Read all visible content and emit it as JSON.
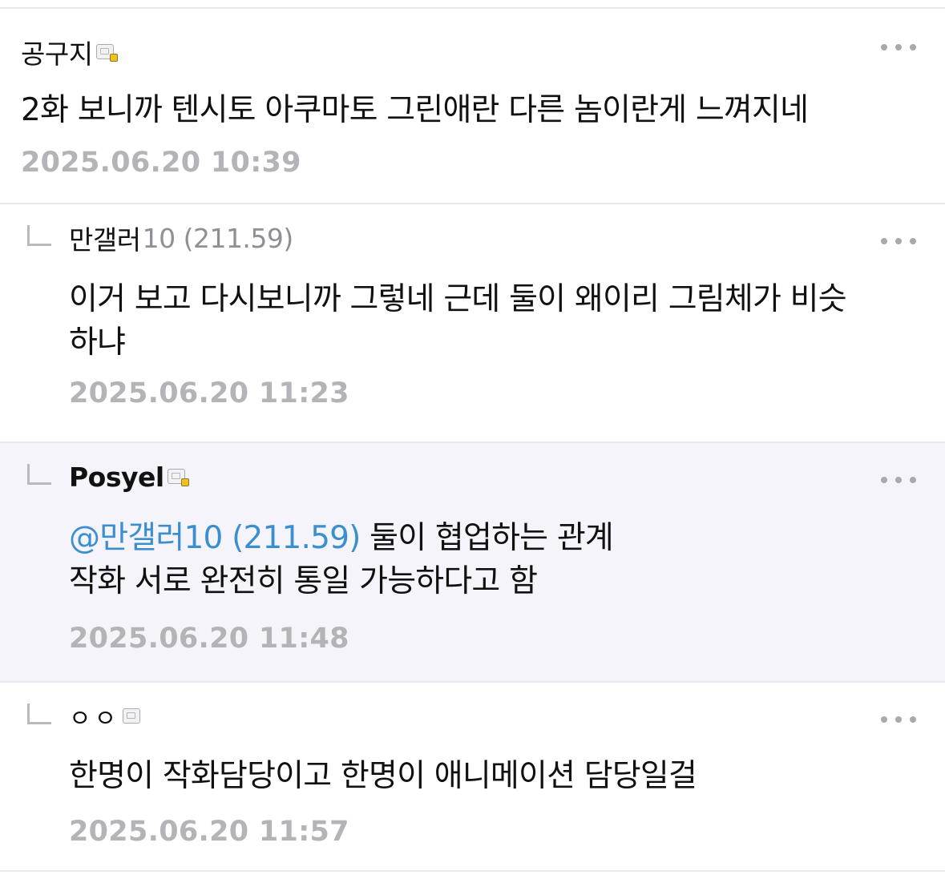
{
  "comments": [
    {
      "author": "공구지",
      "author_id": "",
      "body": "2화 보니까 텐시토 아쿠마토 그린애란 다른 놈이란게 느껴지네",
      "timestamp": "2025.06.20 10:39"
    },
    {
      "author": "만갤러",
      "author_id": "10 (211.59)",
      "body_line1": "이거 보고 다시보니까 그렇네 근데 둘이 왜이리 그림체가 비슷",
      "body_line2": "하냐",
      "timestamp": "2025.06.20 11:23"
    },
    {
      "author": "Posyel",
      "mention": "@만갤러10 (211.59)",
      "body_line1": " 둘이 협업하는 관계",
      "body_line2": "작화 서로 완전히 통일 가능하다고 함",
      "timestamp": "2025.06.20 11:48"
    },
    {
      "author": "ㅇㅇ",
      "body": "한명이 작화담당이고 한명이 애니메이션 담당일걸",
      "timestamp": "2025.06.20 11:57"
    }
  ],
  "icons": {
    "badge": "member-badge-icon",
    "more": "more-options-icon",
    "reply": "reply-arrow-icon"
  },
  "colors": {
    "mention": "#3c8fcf",
    "timestamp": "#b3b3b8",
    "highlight_background": "#f4f4fa"
  }
}
